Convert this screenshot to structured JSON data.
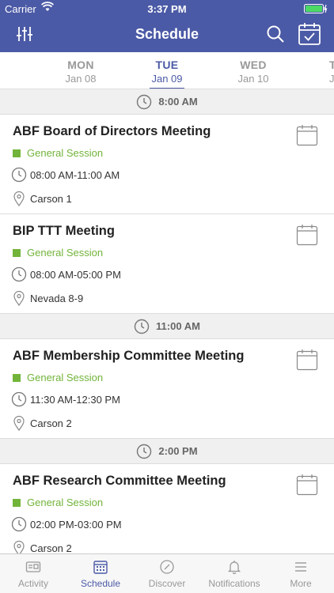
{
  "status_bar": {
    "carrier": "Carrier",
    "time": "3:37 PM"
  },
  "nav": {
    "title": "Schedule"
  },
  "days": [
    {
      "dow": "MON",
      "date": "Jan 08",
      "active": false
    },
    {
      "dow": "TUE",
      "date": "Jan 09",
      "active": true
    },
    {
      "dow": "WED",
      "date": "Jan 10",
      "active": false
    },
    {
      "dow": "T",
      "date": "Ja",
      "active": false
    }
  ],
  "time_headers": [
    "8:00 AM",
    "11:00 AM",
    "2:00 PM"
  ],
  "sessions": [
    {
      "title": "ABF Board of Directors Meeting",
      "track": "General Session",
      "time": "08:00 AM-11:00 AM",
      "location": "Carson 1"
    },
    {
      "title": "BIP TTT Meeting",
      "track": "General Session",
      "time": "08:00 AM-05:00 PM",
      "location": "Nevada 8-9"
    },
    {
      "title": "ABF Membership Committee Meeting",
      "track": "General Session",
      "time": "11:30 AM-12:30 PM",
      "location": "Carson 2"
    },
    {
      "title": "ABF Research Committee Meeting",
      "track": "General Session",
      "time": "02:00 PM-03:00 PM",
      "location": "Carson 2"
    }
  ],
  "tabbar": {
    "items": [
      {
        "label": "Activity",
        "icon": "activity-icon"
      },
      {
        "label": "Schedule",
        "icon": "calendar-grid-icon"
      },
      {
        "label": "Discover",
        "icon": "compass-icon"
      },
      {
        "label": "Notifications",
        "icon": "bell-icon"
      },
      {
        "label": "More",
        "icon": "menu-lines-icon"
      }
    ]
  },
  "colors": {
    "brand": "#4b5aa6",
    "track_green": "#72b43a",
    "divider": "#dddddd"
  }
}
